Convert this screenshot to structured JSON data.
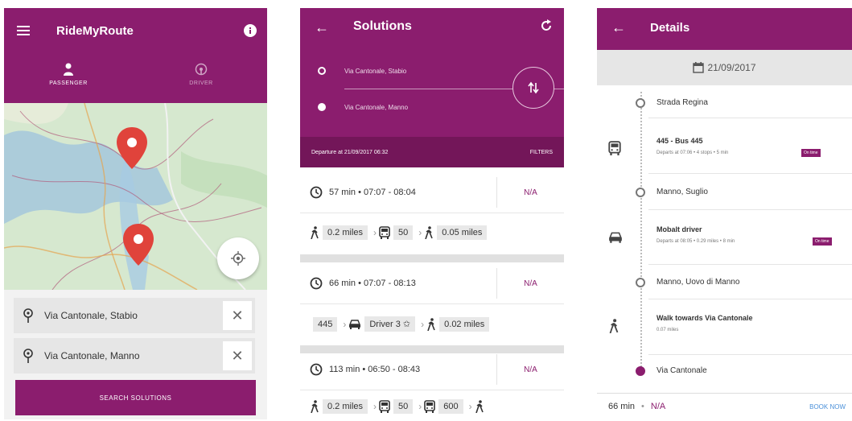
{
  "screen1": {
    "title": "RideMyRoute",
    "tabs": [
      {
        "label": "PASSENGER"
      },
      {
        "label": "DRIVER"
      }
    ],
    "from": "Via Cantonale, Stabio",
    "to": "Via Cantonale, Manno",
    "clear_symbol": "✕",
    "search_label": "SEARCH SOLUTIONS"
  },
  "screen2": {
    "title": "Solutions",
    "from": "Via Cantonale, Stabio",
    "to": "Via Cantonale, Manno",
    "departure": "Departure at 21/09/2017 06:32",
    "filters_label": "FILTERS",
    "solutions": [
      {
        "time": "57 min • 07:07 - 08:04",
        "price": "N/A",
        "steps": [
          {
            "icon": "walk-icon",
            "label": "0.2 miles"
          },
          {
            "icon": "bus-icon",
            "label": "50"
          },
          {
            "icon": "walk-icon",
            "label": "0.05 miles"
          }
        ]
      },
      {
        "time": "66 min • 07:07 - 08:13",
        "price": "N/A",
        "steps": [
          {
            "icon": "",
            "label": "445"
          },
          {
            "icon": "car-icon",
            "label": "Driver 3 ✩"
          },
          {
            "icon": "walk-icon",
            "label": "0.02 miles"
          }
        ]
      },
      {
        "time": "113 min • 06:50 - 08:43",
        "price": "N/A",
        "steps": [
          {
            "icon": "walk-icon",
            "label": "0.2 miles"
          },
          {
            "icon": "bus-icon",
            "label": "50"
          },
          {
            "icon": "bus-icon",
            "label": "600"
          },
          {
            "icon": "walk-icon",
            "label": ""
          }
        ]
      }
    ]
  },
  "screen3": {
    "title": "Details",
    "date": "21/09/2017",
    "stops": [
      {
        "name": "Strada Regina"
      },
      {
        "name": "Manno, Suglio"
      },
      {
        "name": "Manno, Uovo di Manno"
      },
      {
        "name": "Via Cantonale"
      }
    ],
    "segments": [
      {
        "icon": "bus-icon",
        "title": "445 - Bus 445",
        "sub": "Departs at 07:06 • 4 stops • 5 min",
        "badge": "On time"
      },
      {
        "icon": "car-icon",
        "title": "Mobalt driver",
        "sub": "Departs at 08:05 • 0.29 miles • 8 min",
        "badge": "On time"
      },
      {
        "icon": "walk-icon",
        "title": "Walk towards Via Cantonale",
        "sub": "0.07 miles",
        "badge": ""
      }
    ],
    "footer": {
      "duration": "66 min",
      "price": "N/A",
      "book_label": "BOOK NOW"
    }
  },
  "colors": {
    "primary": "#8b1d6e",
    "primary_dark": "#731659",
    "accent_blue": "#4a90d9"
  }
}
